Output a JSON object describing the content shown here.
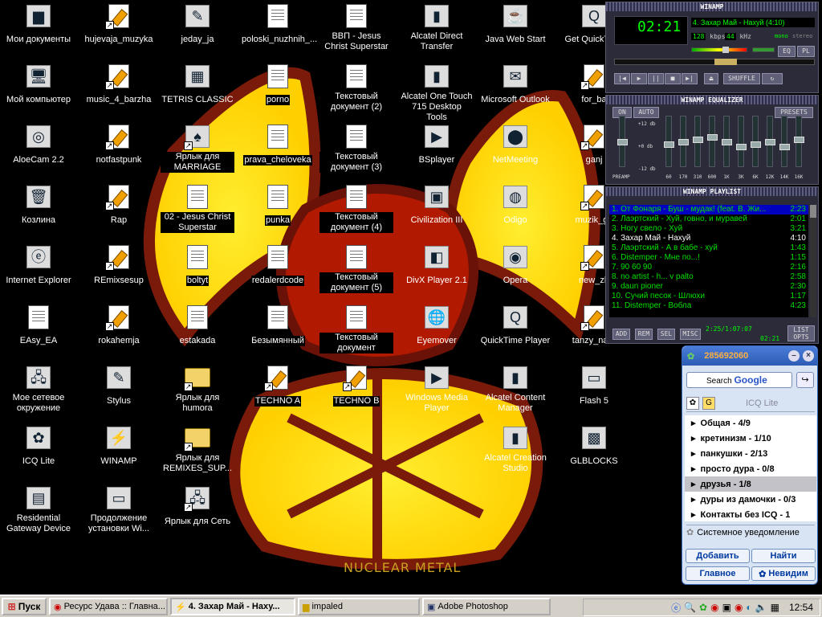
{
  "wallpaper": {
    "text": "NUCLEAR METAL"
  },
  "desktop_icons": [
    {
      "label": "Мои документы",
      "icon": "folder-docs-icon"
    },
    {
      "label": "hujevaja_muzyka",
      "icon": "shortcut-icon"
    },
    {
      "label": "jeday_ja",
      "icon": "paint-icon"
    },
    {
      "label": "poloski_nuzhnih_...",
      "icon": "document-icon"
    },
    {
      "label": "ВВП - Jesus Christ Superstar",
      "icon": "document-icon"
    },
    {
      "label": "Alcatel Direct Transfer",
      "icon": "phone-icon"
    },
    {
      "label": "Java Web Start",
      "icon": "java-icon"
    },
    {
      "label": "Get QuickTime",
      "icon": "quicktime-icon"
    },
    {
      "label": "Мой компьютер",
      "icon": "computer-icon"
    },
    {
      "label": "music_4_barzha",
      "icon": "shortcut-icon"
    },
    {
      "label": "TETRIS CLASSIC",
      "icon": "tetris-icon"
    },
    {
      "label": "porno",
      "icon": "document-icon"
    },
    {
      "label": "Текстовый документ (2)",
      "icon": "document-icon"
    },
    {
      "label": "Alcatel One Touch 715 Desktop Tools",
      "icon": "phone-icon"
    },
    {
      "label": "Microsoft Outlook",
      "icon": "outlook-icon"
    },
    {
      "label": "for_ba",
      "icon": "shortcut-icon"
    },
    {
      "label": "AloeCam 2.2",
      "icon": "webcam-icon"
    },
    {
      "label": "notfastpunk",
      "icon": "shortcut-icon"
    },
    {
      "label": "Ярлык для MARRIAGE",
      "icon": "cards-icon"
    },
    {
      "label": "prava_cheloveka",
      "icon": "document-icon"
    },
    {
      "label": "Текстовый документ (3)",
      "icon": "document-icon"
    },
    {
      "label": "BSplayer",
      "icon": "player-icon"
    },
    {
      "label": "NetMeeting",
      "icon": "netmeeting-icon"
    },
    {
      "label": "ganj",
      "icon": "shortcut-icon"
    },
    {
      "label": "Козлина",
      "icon": "recycle-bin-icon"
    },
    {
      "label": "Rap",
      "icon": "shortcut-icon"
    },
    {
      "label": "02 - Jesus Christ Superstar",
      "icon": "document-icon"
    },
    {
      "label": "punka",
      "icon": "document-icon"
    },
    {
      "label": "Текстовый документ (4)",
      "icon": "document-icon"
    },
    {
      "label": "Civilization III",
      "icon": "civ-icon"
    },
    {
      "label": "Odigo",
      "icon": "odigo-icon"
    },
    {
      "label": "muzik_ga",
      "icon": "shortcut-icon"
    },
    {
      "label": "Internet Explorer",
      "icon": "ie-icon"
    },
    {
      "label": "REmixsesup",
      "icon": "shortcut-icon"
    },
    {
      "label": "boltyt",
      "icon": "document-icon"
    },
    {
      "label": "redalerdcode",
      "icon": "document-icon"
    },
    {
      "label": "Текстовый документ (5)",
      "icon": "document-icon"
    },
    {
      "label": "DivX Player 2.1",
      "icon": "divx-icon"
    },
    {
      "label": "Opera",
      "icon": "opera-icon"
    },
    {
      "label": "new_zb",
      "icon": "shortcut-icon"
    },
    {
      "label": "EAsy_EA",
      "icon": "document-icon"
    },
    {
      "label": "rokahemja",
      "icon": "shortcut-icon"
    },
    {
      "label": "estakada",
      "icon": "document-icon"
    },
    {
      "label": "Безымянный",
      "icon": "document-icon"
    },
    {
      "label": "Текстовый документ",
      "icon": "document-icon"
    },
    {
      "label": "Eyemover",
      "icon": "globe-icon"
    },
    {
      "label": "QuickTime Player",
      "icon": "quicktime-icon"
    },
    {
      "label": "tanzy_naro",
      "icon": "shortcut-icon"
    },
    {
      "label": "Мое сетевое окружение",
      "icon": "network-icon"
    },
    {
      "label": "Stylus",
      "icon": "stylus-icon"
    },
    {
      "label": "Ярлык для humora",
      "icon": "folder-icon"
    },
    {
      "label": "TECHNO A",
      "icon": "shortcut-icon"
    },
    {
      "label": "TECHNO B",
      "icon": "shortcut-icon"
    },
    {
      "label": "Windows Media Player",
      "icon": "wmp-icon"
    },
    {
      "label": "Alcatel Content Manager",
      "icon": "phone-icon"
    },
    {
      "label": "Flash 5",
      "icon": "window-icon"
    },
    {
      "label": "ICQ Lite",
      "icon": "icq-icon"
    },
    {
      "label": "WINAMP",
      "icon": "winamp-icon"
    },
    {
      "label": "Ярлык для REMIXES_SUP...",
      "icon": "folder-icon"
    },
    {
      "label": "Alcatel Creation Studio",
      "icon": "phone-icon"
    },
    {
      "label": "GLBLOCKS",
      "icon": "blocks-icon"
    },
    {
      "label": "Residential Gateway Device",
      "icon": "gateway-icon"
    },
    {
      "label": "Продолжение установки Wi...",
      "icon": "window-icon"
    },
    {
      "label": "Ярлык для Сеть",
      "icon": "network-icon"
    }
  ],
  "winamp": {
    "title": "WINAMP",
    "time": "02:21",
    "track": "4. Захар Май - Нахуй (4:10)",
    "kbps": "128",
    "kbps_unit": "kbps",
    "khz": "44",
    "khz_unit": "kHz",
    "mode": "mono",
    "mode_stereo": "stereo",
    "btn_eq": "EQ",
    "btn_pl": "PL",
    "shuffle": "SHUFFLE",
    "progress_fraction": 0.56,
    "volume_fraction": 0.62,
    "balance_fraction": 0.5
  },
  "equalizer": {
    "title": "WINAMP EQUALIZER",
    "on": "ON",
    "auto": "AUTO",
    "presets": "PRESETS",
    "db_top": "+12 db",
    "db_mid": "+0 db",
    "db_bot": "-12 db",
    "preamp": "PREAMP",
    "bands": [
      "60",
      "170",
      "310",
      "600",
      "1K",
      "3K",
      "6K",
      "12K",
      "14K",
      "16K"
    ],
    "preamp_level": 0.5,
    "band_levels": [
      0.45,
      0.5,
      0.55,
      0.6,
      0.5,
      0.4,
      0.45,
      0.5,
      0.4,
      0.55
    ]
  },
  "playlist": {
    "title": "WINAMP PLAYLIST",
    "items": [
      {
        "text": "1. От Фонаря - Буш - мудак! (feat. В. Жи...",
        "time": "2:23"
      },
      {
        "text": "2. Лаэртский - Хуй, говно, и муравей",
        "time": "2:01"
      },
      {
        "text": "3. Ногу свело - Хуй",
        "time": "3:21"
      },
      {
        "text": "4. Захар Май - Нахуй",
        "time": "4:10"
      },
      {
        "text": "5. Лаэртский - А в бабе - хуй",
        "time": "1:43"
      },
      {
        "text": "6. Distemper - Мне по...!",
        "time": "1:15"
      },
      {
        "text": "7. 90 60 90",
        "time": "2:16"
      },
      {
        "text": "8. no artist - h... v palto",
        "time": "2:58"
      },
      {
        "text": "9. daun pioner",
        "time": "2:30"
      },
      {
        "text": "10. Сучий песок - Шлюхи",
        "time": "1:17"
      },
      {
        "text": "11. Distemper - Вобла",
        "time": "4:23"
      }
    ],
    "btn_add": "ADD",
    "btn_rem": "REM",
    "btn_sel": "SEL",
    "btn_misc": "MISC",
    "counter": "2:25/1:07:07",
    "mini_time": "02:21",
    "list_opts": "LIST OPTS"
  },
  "icq": {
    "uin": "285692060",
    "search_prefix": "Search",
    "search_brand": "Google",
    "tab_label": "ICQ Lite",
    "groups": [
      "Общая - 4/9",
      "кретинизм - 1/10",
      "панкушки - 2/13",
      "просто дура - 0/8",
      "друзья - 1/8",
      "дуры из дамочки - 0/3",
      "Контакты без ICQ - 1"
    ],
    "system_notice": "Системное уведомление",
    "btn_add": "Добавить",
    "btn_find": "Найти",
    "btn_main": "Главное",
    "btn_status": "Невидим"
  },
  "taskbar": {
    "start": "Пуск",
    "tasks": [
      {
        "label": "Ресурс Удава :: Главна...",
        "icon": "opera-icon"
      },
      {
        "label": "4. Захар Май - Наху...",
        "icon": "winamp-icon"
      },
      {
        "label": "impaled",
        "icon": "folder-icon"
      },
      {
        "label": "Adobe Photoshop",
        "icon": "photoshop-icon"
      }
    ],
    "clock": "12:54"
  }
}
